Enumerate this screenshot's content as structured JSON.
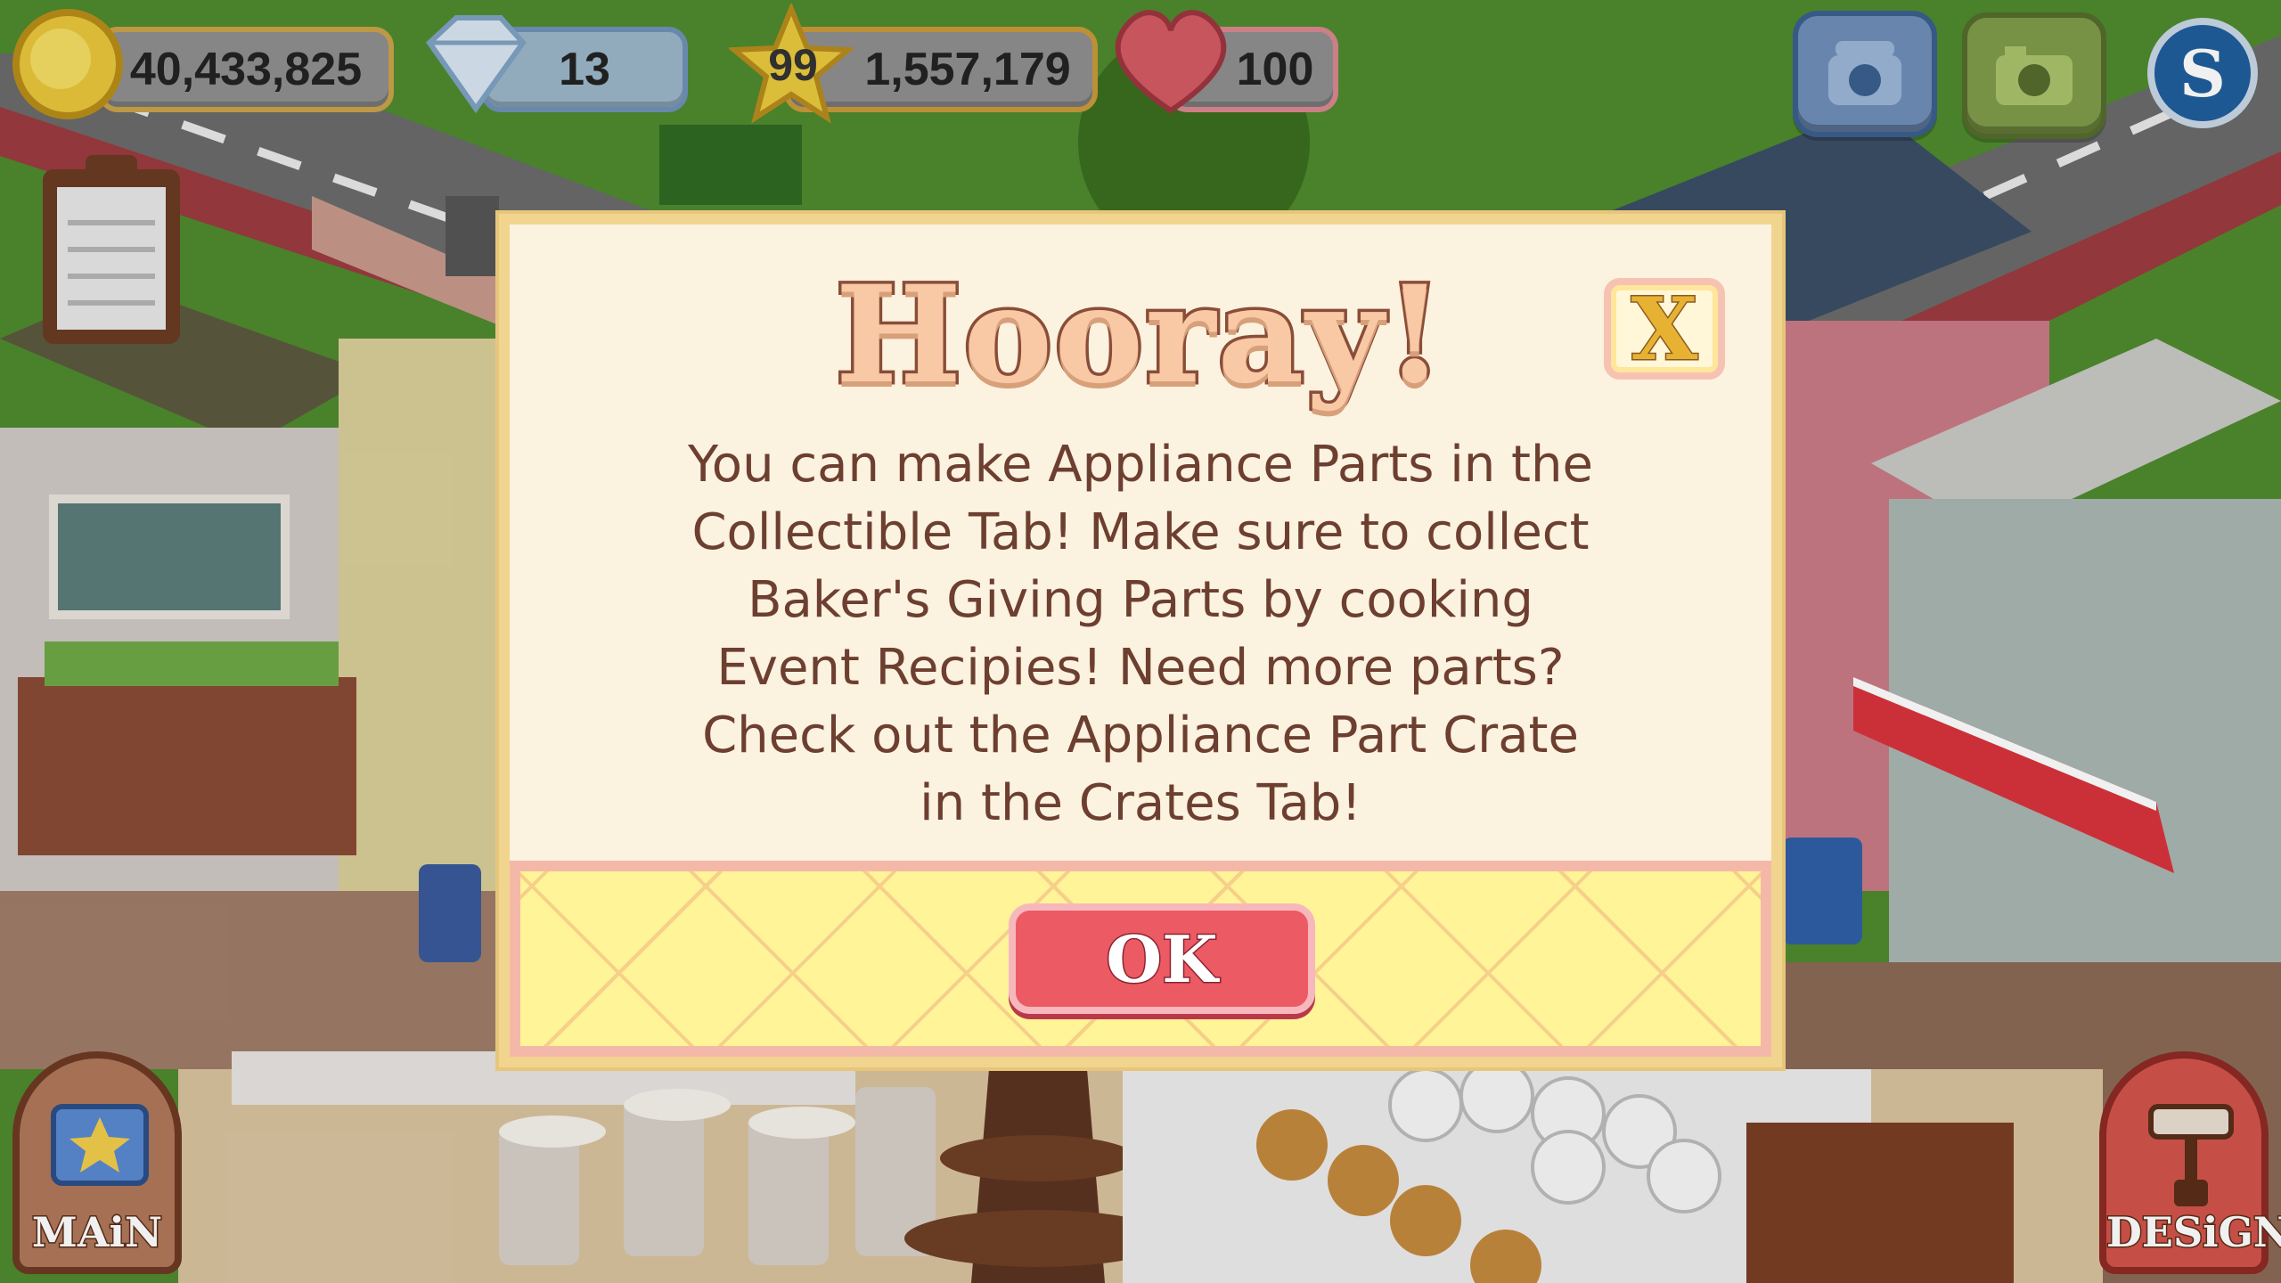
{
  "hud": {
    "coins": "40,433,825",
    "gems": "13",
    "level": "99",
    "xp": "1,557,179",
    "hearts": "100"
  },
  "icons": {
    "coin": "coin-icon",
    "gem": "gem-icon",
    "star": "star-icon",
    "heart": "heart-icon",
    "phone": "phone-icon",
    "camera": "camera-icon",
    "social": "social-s-icon",
    "clipboard": "clipboard-icon",
    "book": "recipe-book-icon",
    "design": "paint-roller-icon"
  },
  "dialog": {
    "title": "Hooray!",
    "close_label": "X",
    "message_lines": [
      "You can make Appliance Parts in the",
      "Collectible Tab! Make sure to collect",
      "Baker's Giving Parts by cooking",
      "Event Recipies! Need more parts?",
      "Check out the Appliance Part Crate",
      "in the Crates Tab!"
    ],
    "ok_label": "OK"
  },
  "nav": {
    "main_label": "MAiN",
    "design_label": "DESiGN"
  },
  "colors": {
    "modal_bg": "#fbf2df",
    "footer_bg": "#fff497",
    "ok_button": "#ec5a64",
    "text": "#6d3f30"
  }
}
